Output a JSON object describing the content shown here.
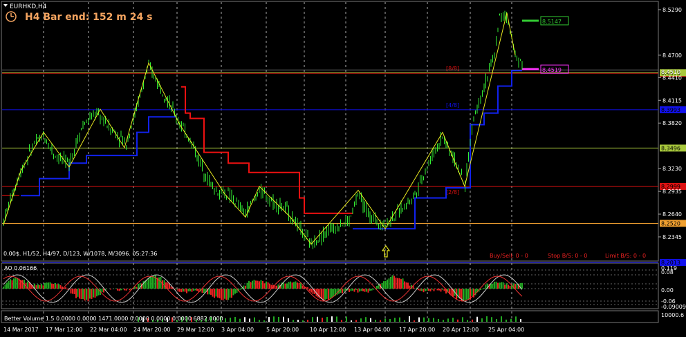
{
  "window": {
    "symbol_title": "EURHKD,H4"
  },
  "bar_end": {
    "text": "H4 Bar end: 152 m 24 s"
  },
  "info_line": {
    "text": "0.00$. H1/52, H4/97, D/123, W/1078, M/3096. 05:27:36"
  },
  "status": {
    "buy_sell": "Buy/Sell:  0 - 0",
    "stop_bs": "Stop B/S:  0 - 0",
    "limit_bs": "Limit B/S:  0 - 0"
  },
  "ao": {
    "label": "AO 0.06166",
    "ticks": [
      "0.119",
      "0.08",
      "0.00",
      "-0.06",
      "-0.09009"
    ]
  },
  "volume": {
    "label": "Better Volume 1.5  0.0000  0.0000  1471.0000  0.0000  0.0000  0.0000  6882.0000",
    "tick": "10000.6"
  },
  "price_axis": [
    "8.5290",
    "8.4700",
    "8.4410",
    "8.4115",
    "8.3820",
    "8.3230",
    "8.2935",
    "8.2640",
    "8.2345"
  ],
  "levels": [
    {
      "name": "level-8-8",
      "price": "8.4465",
      "color": "#dd1111",
      "label": "[8/8]",
      "boxed": true
    },
    {
      "name": "level-olive-top",
      "price": "8.4473",
      "color": "#a8c83c",
      "label": "",
      "boxed": true
    },
    {
      "name": "level-4-8",
      "price": "8.3993",
      "color": "#1111ee",
      "label": "[4/8]",
      "boxed": true
    },
    {
      "name": "level-olive-mid",
      "price": "8.3496",
      "color": "#a8c83c",
      "label": "",
      "boxed": true
    },
    {
      "name": "level-2-8",
      "price": "8.2999",
      "color": "#dd1111",
      "label": "[2/8]",
      "boxed": true
    },
    {
      "name": "level-orange",
      "price": "8.2520",
      "color": "#f0a030",
      "label": "",
      "boxed": true
    },
    {
      "name": "level-blue-bottom",
      "price": "8.2013",
      "color": "#1111ee",
      "label": "",
      "boxed": true
    }
  ],
  "markers": [
    {
      "name": "green-price-marker",
      "price": "8.5147",
      "color": "#33cc33"
    },
    {
      "name": "magenta-price-marker",
      "price": "8.4519",
      "color": "#ff33ff"
    }
  ],
  "current_price": "8.4510",
  "time_axis": [
    "14 Mar 2017",
    "17 Mar 12:00",
    "22 Mar 04:00",
    "24 Mar 20:00",
    "29 Mar 12:00",
    "3 Apr 04:00",
    "5 Apr 20:00",
    "10 Apr 12:00",
    "13 Apr 04:00",
    "17 Apr 20:00",
    "20 Apr 12:00",
    "25 Apr 04:00"
  ],
  "colors": {
    "candle": "#33ee33",
    "zigzag": "#e8e820",
    "stop_red": "#ee1111",
    "stop_blue": "#1122ee",
    "ao_up": "#22aa22",
    "ao_down": "#ee2222",
    "volume": "#22aa22"
  }
}
